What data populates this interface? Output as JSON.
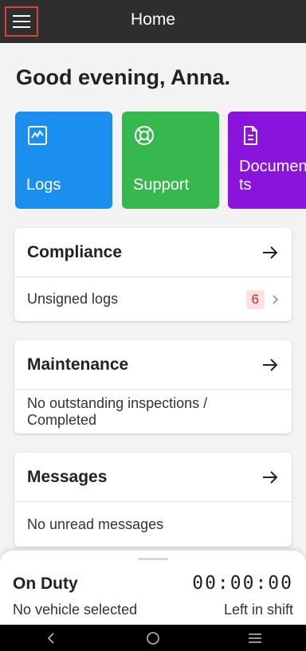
{
  "header": {
    "title": "Home"
  },
  "greeting": "Good evening, Anna.",
  "tiles": [
    {
      "label": "Logs",
      "color": "#1a8ff0",
      "icon": "chart-icon"
    },
    {
      "label": "Support",
      "color": "#36b84f",
      "icon": "lifebuoy-icon"
    },
    {
      "label": "Documents",
      "label_lines": [
        "Documen",
        "ts"
      ],
      "color": "#8a14dc",
      "icon": "document-icon"
    }
  ],
  "cards": {
    "compliance": {
      "title": "Compliance",
      "item": "Unsigned logs",
      "badge": "6"
    },
    "maintenance": {
      "title": "Maintenance",
      "item": "No outstanding inspections / Completed",
      "item_lines": [
        "No outstanding inspections /",
        "Completed"
      ]
    },
    "messages": {
      "title": "Messages",
      "item": "No unread messages"
    }
  },
  "duty": {
    "status": "On Duty",
    "timer": "00:00:00",
    "vehicle": "No vehicle selected",
    "shift_label": "Left in shift"
  },
  "nav": [
    "back-icon",
    "home-icon",
    "recents-icon"
  ]
}
